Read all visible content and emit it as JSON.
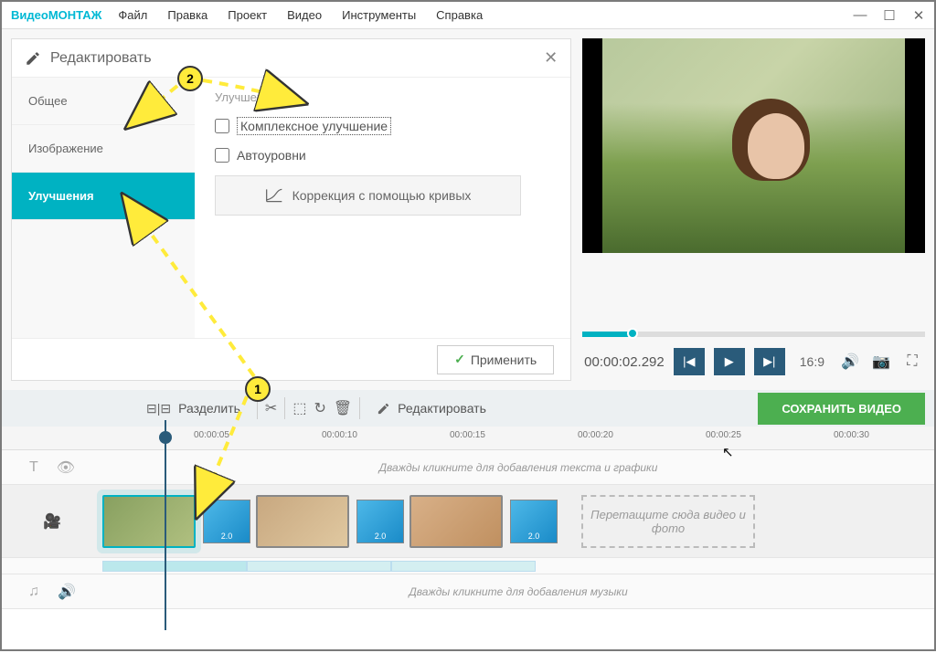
{
  "app": {
    "logo_a": "Видео",
    "logo_b": "МОНТАЖ"
  },
  "menu": [
    "Файл",
    "Правка",
    "Проект",
    "Видео",
    "Инструменты",
    "Справка"
  ],
  "edit_panel": {
    "title": "Редактировать",
    "tabs": [
      "Общее",
      "Изображение",
      "Улучшения"
    ],
    "section": "Улучшения",
    "checkbox_complex": "Комплексное улучшение",
    "checkbox_auto": "Автоуровни",
    "curves_btn": "Коррекция с помощью кривых",
    "apply": "Применить"
  },
  "preview": {
    "time": "00:00:02.292",
    "ratio": "16:9"
  },
  "toolbar": {
    "split": "Разделить",
    "edit": "Редактировать",
    "save": "СОХРАНИТЬ ВИДЕО"
  },
  "timeline": {
    "marks": [
      "00:00:05",
      "00:00:10",
      "00:00:15",
      "00:00:20",
      "00:00:25",
      "00:00:30"
    ],
    "text_track_hint": "Дважды кликните для добавления текста и графики",
    "music_track_hint": "Дважды кликните для добавления музыки",
    "drop_zone": "Перетащите сюда видео и фото",
    "transition_dur": "2.0"
  },
  "callouts": {
    "one": "1",
    "two": "2"
  }
}
